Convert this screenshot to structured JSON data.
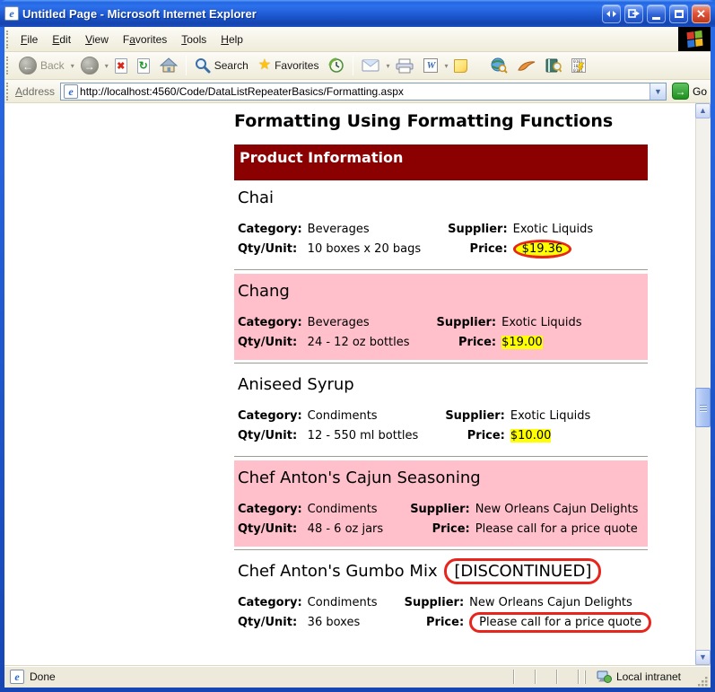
{
  "window": {
    "title": "Untitled Page - Microsoft Internet Explorer"
  },
  "menu": {
    "items": [
      {
        "pre": "",
        "key": "F",
        "post": "ile"
      },
      {
        "pre": "",
        "key": "E",
        "post": "dit"
      },
      {
        "pre": "",
        "key": "V",
        "post": "iew"
      },
      {
        "pre": "F",
        "key": "a",
        "post": "vorites"
      },
      {
        "pre": "",
        "key": "T",
        "post": "ools"
      },
      {
        "pre": "",
        "key": "H",
        "post": "elp"
      }
    ]
  },
  "toolbar": {
    "back_label": "Back",
    "search_label": "Search",
    "favorites_label": "Favorites"
  },
  "address": {
    "label": {
      "pre": "",
      "key": "A",
      "post": "ddress"
    },
    "url": "http://localhost:4560/Code/DataListRepeaterBasics/Formatting.aspx",
    "go_label": "Go"
  },
  "page": {
    "heading": "Formatting Using Formatting Functions",
    "banner": "Product Information",
    "labels": {
      "category": "Category:",
      "supplier": "Supplier:",
      "qty": "Qty/Unit:",
      "price": "Price:"
    },
    "products": [
      {
        "name": "Chai",
        "category": "Beverages",
        "supplier": "Exotic Liquids",
        "qty": "10 boxes x 20 bags",
        "price": "$19.36"
      },
      {
        "name": "Chang",
        "category": "Beverages",
        "supplier": "Exotic Liquids",
        "qty": "24 - 12 oz bottles",
        "price": "$19.00"
      },
      {
        "name": "Aniseed Syrup",
        "category": "Condiments",
        "supplier": "Exotic Liquids",
        "qty": "12 - 550 ml bottles",
        "price": "$10.00"
      },
      {
        "name": "Chef Anton's Cajun Seasoning",
        "category": "Condiments",
        "supplier": "New Orleans Cajun Delights",
        "qty": "48 - 6 oz jars",
        "price": "Please call for a price quote"
      },
      {
        "name": "Chef Anton's Gumbo Mix",
        "discontinued": "[DISCONTINUED]",
        "category": "Condiments",
        "supplier": "New Orleans Cajun Delights",
        "qty": "36 boxes",
        "price": "Please call for a price quote"
      }
    ]
  },
  "status": {
    "done": "Done",
    "zone": "Local intranet"
  },
  "colors": {
    "banner_bg": "#8B0000",
    "item_alt_bg": "#FFC0CB",
    "price_highlight": "#FFFF00",
    "annotation_red": "#E8251C",
    "titlebar_blue": "#1E5AD6",
    "chrome_tan": "#ECE9D8"
  }
}
